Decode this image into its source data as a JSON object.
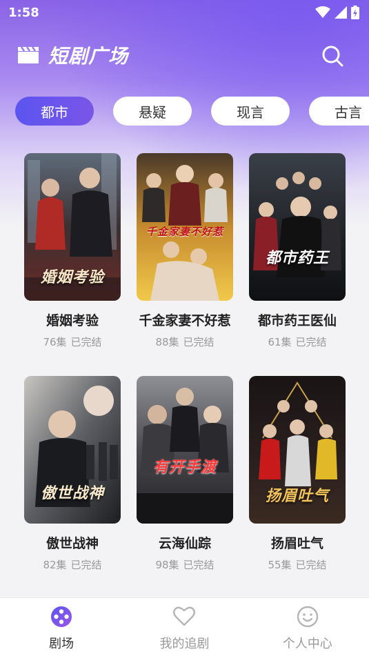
{
  "status_bar": {
    "time": "1:58"
  },
  "app": {
    "title": "短剧广场"
  },
  "icons": {
    "clapper": "clapperboard-icon",
    "search": "search-icon",
    "theater": "film-reel-icon",
    "heart": "heart-icon",
    "profile": "smiley-face-icon"
  },
  "colors": {
    "accent": "#6a55ee",
    "header_gradient_top": "#8a63e6",
    "background": "#f3f3f5"
  },
  "tabs": [
    {
      "label": "都市",
      "active": true
    },
    {
      "label": "悬疑",
      "active": false
    },
    {
      "label": "现言",
      "active": false
    },
    {
      "label": "古言",
      "active": false
    }
  ],
  "dramas": [
    {
      "title": "婚姻考验",
      "episodes": "76集",
      "status": "已完结",
      "poster_text": "婚姻考验"
    },
    {
      "title": "千金家妻不好惹",
      "episodes": "88集",
      "status": "已完结",
      "poster_text": "千金家妻不好惹"
    },
    {
      "title": "都市药王医仙",
      "episodes": "61集",
      "status": "已完结",
      "poster_text": "都市药王"
    },
    {
      "title": "傲世战神",
      "episodes": "82集",
      "status": "已完结",
      "poster_text": "傲世战神"
    },
    {
      "title": "云海仙踪",
      "episodes": "98集",
      "status": "已完结",
      "poster_text": "有开手渡"
    },
    {
      "title": "扬眉吐气",
      "episodes": "55集",
      "status": "已完结",
      "poster_text": "扬眉吐气"
    }
  ],
  "bottom_nav": [
    {
      "label": "剧场",
      "active": true
    },
    {
      "label": "我的追剧",
      "active": false
    },
    {
      "label": "个人中心",
      "active": false
    }
  ]
}
